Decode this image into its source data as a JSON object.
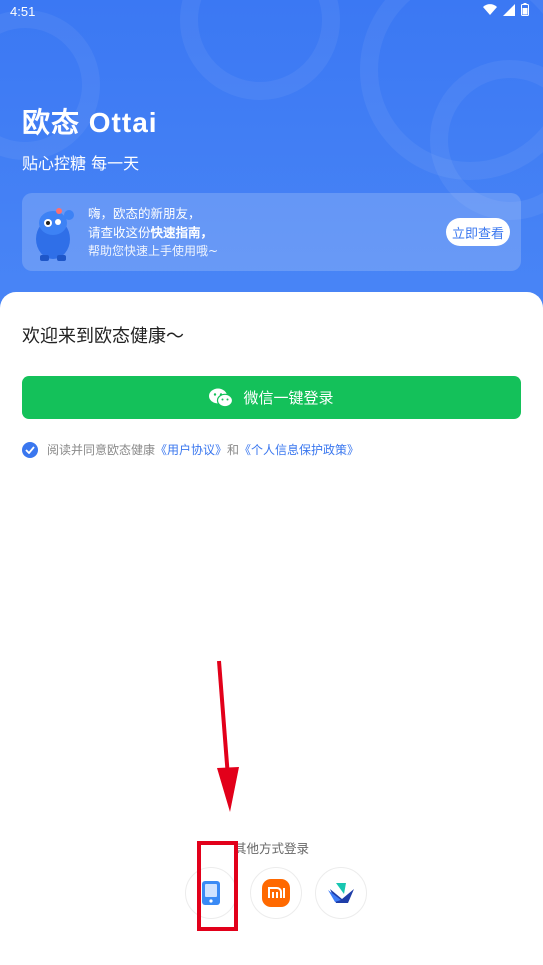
{
  "status_bar": {
    "time": "4:51"
  },
  "header": {
    "brand": "欧态 Ottai",
    "tagline": "贴心控糖 每一天"
  },
  "guide_card": {
    "line1": "嗨，欧态的新朋友，",
    "line2_prefix": "请查收这份",
    "line2_bold": "快速指南，",
    "line3": "帮助您快速上手使用哦~",
    "button": "立即查看"
  },
  "login": {
    "welcome": "欢迎来到欧态健康～",
    "wechat_button": "微信一键登录",
    "agreement_prefix": "阅读并同意欧态健康",
    "user_agreement": "《用户协议》",
    "agreement_and": "和",
    "privacy_policy": "《个人信息保护政策》",
    "other_methods": "其他方式登录",
    "methods": [
      "phone-icon",
      "xiaomi-icon",
      "feishu-icon"
    ]
  },
  "colors": {
    "primary_blue": "#3a77ef",
    "wechat_green": "#14c15a",
    "xiaomi_orange": "#ff6900",
    "annotation_red": "#e2001a"
  }
}
